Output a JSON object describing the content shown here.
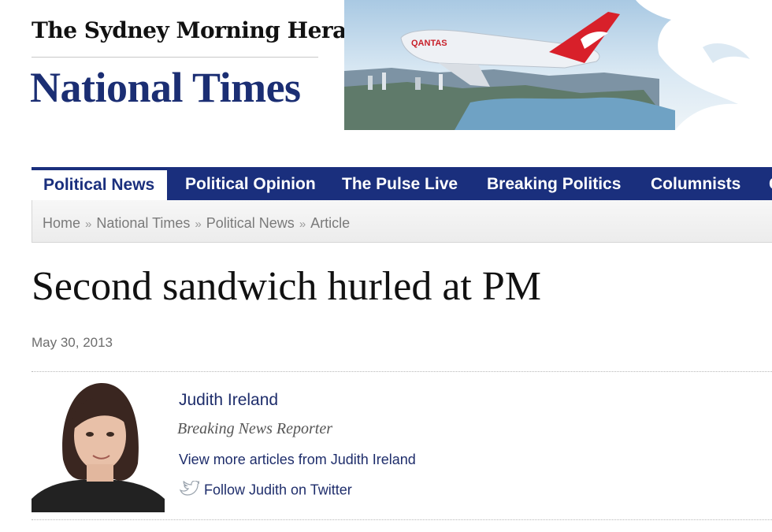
{
  "masthead": {
    "top_title": "The Sydney Morning Herald",
    "section_title": "National Times"
  },
  "banner": {
    "airline_label": "QANTAS",
    "icon": "kangaroo-icon",
    "colors": {
      "sky": "#cfe3f2",
      "tail": "#d8202a",
      "fuselage": "#eef1f5"
    }
  },
  "nav": {
    "tabs": [
      {
        "label": "Political News",
        "active": true
      },
      {
        "label": "Political Opinion"
      },
      {
        "label": "The Pulse Live"
      },
      {
        "label": "Breaking Politics"
      },
      {
        "label": "Columnists"
      },
      {
        "label": "C"
      }
    ],
    "colors": {
      "bar": "#1a2f7d",
      "active_bg": "#ffffff"
    }
  },
  "breadcrumb": {
    "items": [
      "Home",
      "National Times",
      "Political News",
      "Article"
    ],
    "separator": "»"
  },
  "article": {
    "headline": "Second sandwich hurled at PM",
    "date": "May 30, 2013"
  },
  "author": {
    "name": "Judith Ireland",
    "role": "Breaking News Reporter",
    "more_link": "View more articles from Judith Ireland",
    "twitter_link": "Follow Judith on Twitter",
    "twitter_icon": "twitter-bird-icon"
  }
}
